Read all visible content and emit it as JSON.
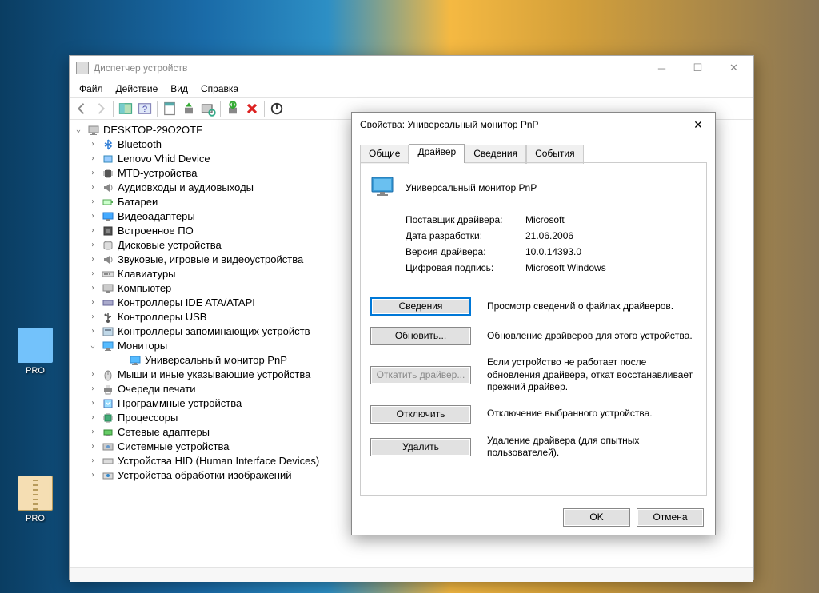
{
  "desktop": {
    "icon1_label": "PRO",
    "icon2_label": "PRO"
  },
  "dm": {
    "title": "Диспетчер устройств",
    "menu": {
      "file": "Файл",
      "action": "Действие",
      "view": "Вид",
      "help": "Справка"
    },
    "root": "DESKTOP-29O2OTF",
    "nodes": [
      {
        "label": "Bluetooth",
        "icon": "bluetooth"
      },
      {
        "label": "Lenovo Vhid Device",
        "icon": "device"
      },
      {
        "label": "MTD-устройства",
        "icon": "chip"
      },
      {
        "label": "Аудиовходы и аудиовыходы",
        "icon": "audio"
      },
      {
        "label": "Батареи",
        "icon": "battery"
      },
      {
        "label": "Видеоадаптеры",
        "icon": "display"
      },
      {
        "label": "Встроенное ПО",
        "icon": "firmware"
      },
      {
        "label": "Дисковые устройства",
        "icon": "disk"
      },
      {
        "label": "Звуковые, игровые и видеоустройства",
        "icon": "audio"
      },
      {
        "label": "Клавиатуры",
        "icon": "keyboard"
      },
      {
        "label": "Компьютер",
        "icon": "computer"
      },
      {
        "label": "Контроллеры IDE ATA/ATAPI",
        "icon": "ide"
      },
      {
        "label": "Контроллеры USB",
        "icon": "usb"
      },
      {
        "label": "Контроллеры запоминающих устройств",
        "icon": "storage"
      },
      {
        "label": "Мониторы",
        "icon": "monitor",
        "expanded": true,
        "children": [
          {
            "label": "Универсальный монитор PnP",
            "icon": "monitor"
          }
        ]
      },
      {
        "label": "Мыши и иные указывающие устройства",
        "icon": "mouse"
      },
      {
        "label": "Очереди печати",
        "icon": "printer"
      },
      {
        "label": "Программные устройства",
        "icon": "software"
      },
      {
        "label": "Процессоры",
        "icon": "cpu"
      },
      {
        "label": "Сетевые адаптеры",
        "icon": "network"
      },
      {
        "label": "Системные устройства",
        "icon": "system"
      },
      {
        "label": "Устройства HID (Human Interface Devices)",
        "icon": "hid"
      },
      {
        "label": "Устройства обработки изображений",
        "icon": "imaging"
      }
    ]
  },
  "dlg": {
    "title": "Свойства: Универсальный монитор PnP",
    "tabs": {
      "general": "Общие",
      "driver": "Драйвер",
      "details": "Сведения",
      "events": "События"
    },
    "device_name": "Универсальный монитор PnP",
    "provider_k": "Поставщик драйвера:",
    "provider_v": "Microsoft",
    "date_k": "Дата разработки:",
    "date_v": "21.06.2006",
    "version_k": "Версия драйвера:",
    "version_v": "10.0.14393.0",
    "signer_k": "Цифровая подпись:",
    "signer_v": "Microsoft Windows",
    "btn_details": "Сведения",
    "desc_details": "Просмотр сведений о файлах драйверов.",
    "btn_update": "Обновить...",
    "desc_update": "Обновление драйверов для этого устройства.",
    "btn_rollback": "Откатить драйвер...",
    "desc_rollback": "Если устройство не работает после обновления драйвера, откат восстанавливает прежний драйвер.",
    "btn_disable": "Отключить",
    "desc_disable": "Отключение выбранного устройства.",
    "btn_uninstall": "Удалить",
    "desc_uninstall": "Удаление драйвера (для опытных пользователей).",
    "ok": "OK",
    "cancel": "Отмена"
  }
}
